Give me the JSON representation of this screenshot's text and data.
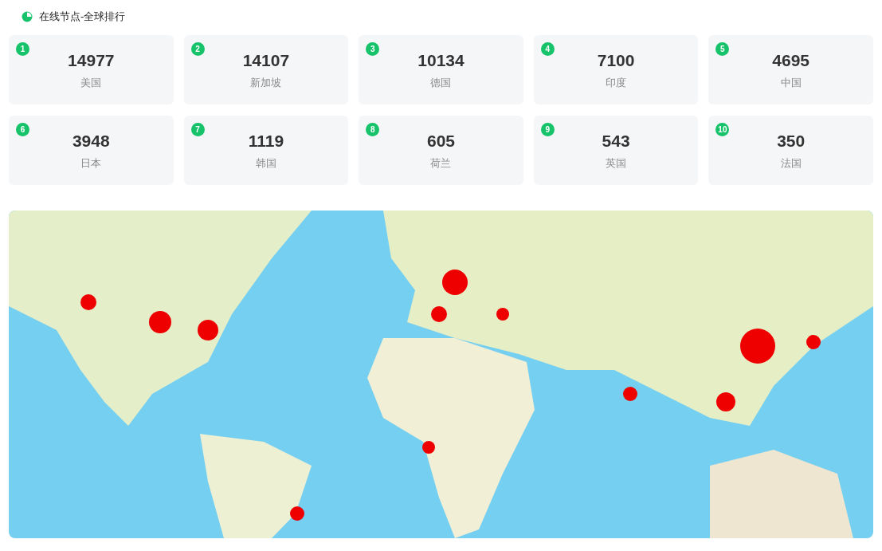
{
  "title": "在线节点-全球排行",
  "cards": [
    {
      "rank": "1",
      "value": "14977",
      "country": "美国"
    },
    {
      "rank": "2",
      "value": "14107",
      "country": "新加坡"
    },
    {
      "rank": "3",
      "value": "10134",
      "country": "德国"
    },
    {
      "rank": "4",
      "value": "7100",
      "country": "印度"
    },
    {
      "rank": "5",
      "value": "4695",
      "country": "中国"
    },
    {
      "rank": "6",
      "value": "3948",
      "country": "日本"
    },
    {
      "rank": "7",
      "value": "1119",
      "country": "韩国"
    },
    {
      "rank": "8",
      "value": "605",
      "country": "荷兰"
    },
    {
      "rank": "9",
      "value": "543",
      "country": "英国"
    },
    {
      "rank": "10",
      "value": "350",
      "country": "法国"
    }
  ]
}
